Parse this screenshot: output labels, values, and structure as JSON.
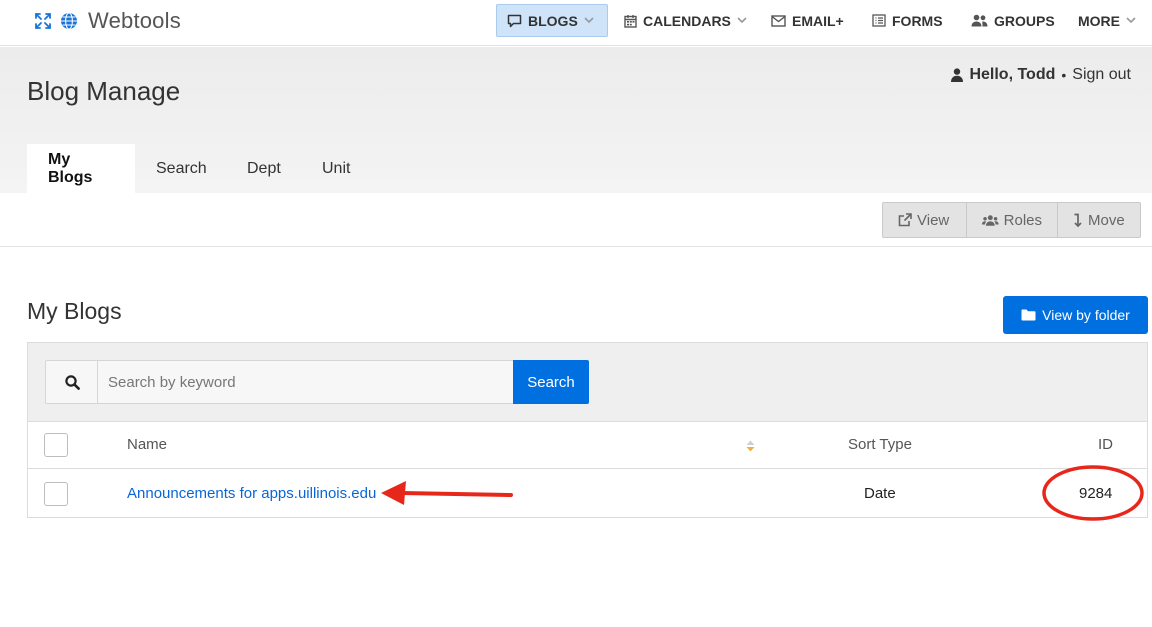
{
  "brand": {
    "name": "Webtools"
  },
  "nav": {
    "items": [
      {
        "label": "BLOGS",
        "icon": "comment-icon",
        "dropdown": true,
        "active": true
      },
      {
        "label": "CALENDARS",
        "icon": "calendar-icon",
        "dropdown": true
      },
      {
        "label": "EMAIL+",
        "icon": "envelope-icon",
        "dropdown": false
      },
      {
        "label": "FORMS",
        "icon": "list-icon",
        "dropdown": false
      },
      {
        "label": "GROUPS",
        "icon": "users-icon",
        "dropdown": false
      },
      {
        "label": "MORE",
        "icon": "",
        "dropdown": true
      }
    ]
  },
  "header": {
    "title": "Blog Manage",
    "user": {
      "greeting": "Hello, Todd",
      "separator": "•",
      "signout": "Sign out"
    }
  },
  "tabs": [
    {
      "label": "My Blogs",
      "active": true
    },
    {
      "label": "Search"
    },
    {
      "label": "Dept"
    },
    {
      "label": "Unit"
    }
  ],
  "actions": {
    "view": "View",
    "roles": "Roles",
    "move": "Move"
  },
  "section": {
    "title": "My Blogs",
    "folder_button": "View by folder"
  },
  "search": {
    "placeholder": "Search by keyword",
    "value": "",
    "button": "Search"
  },
  "table": {
    "columns": {
      "name": "Name",
      "sort_type": "Sort Type",
      "id": "ID"
    },
    "rows": [
      {
        "name": "Announcements for apps.uillinois.edu",
        "sort_type": "Date",
        "id": "9284"
      }
    ]
  },
  "colors": {
    "primary": "#0070e0",
    "active_nav": "#cfe3f9",
    "annotation": "#e8271b",
    "link": "#0a66d8"
  }
}
